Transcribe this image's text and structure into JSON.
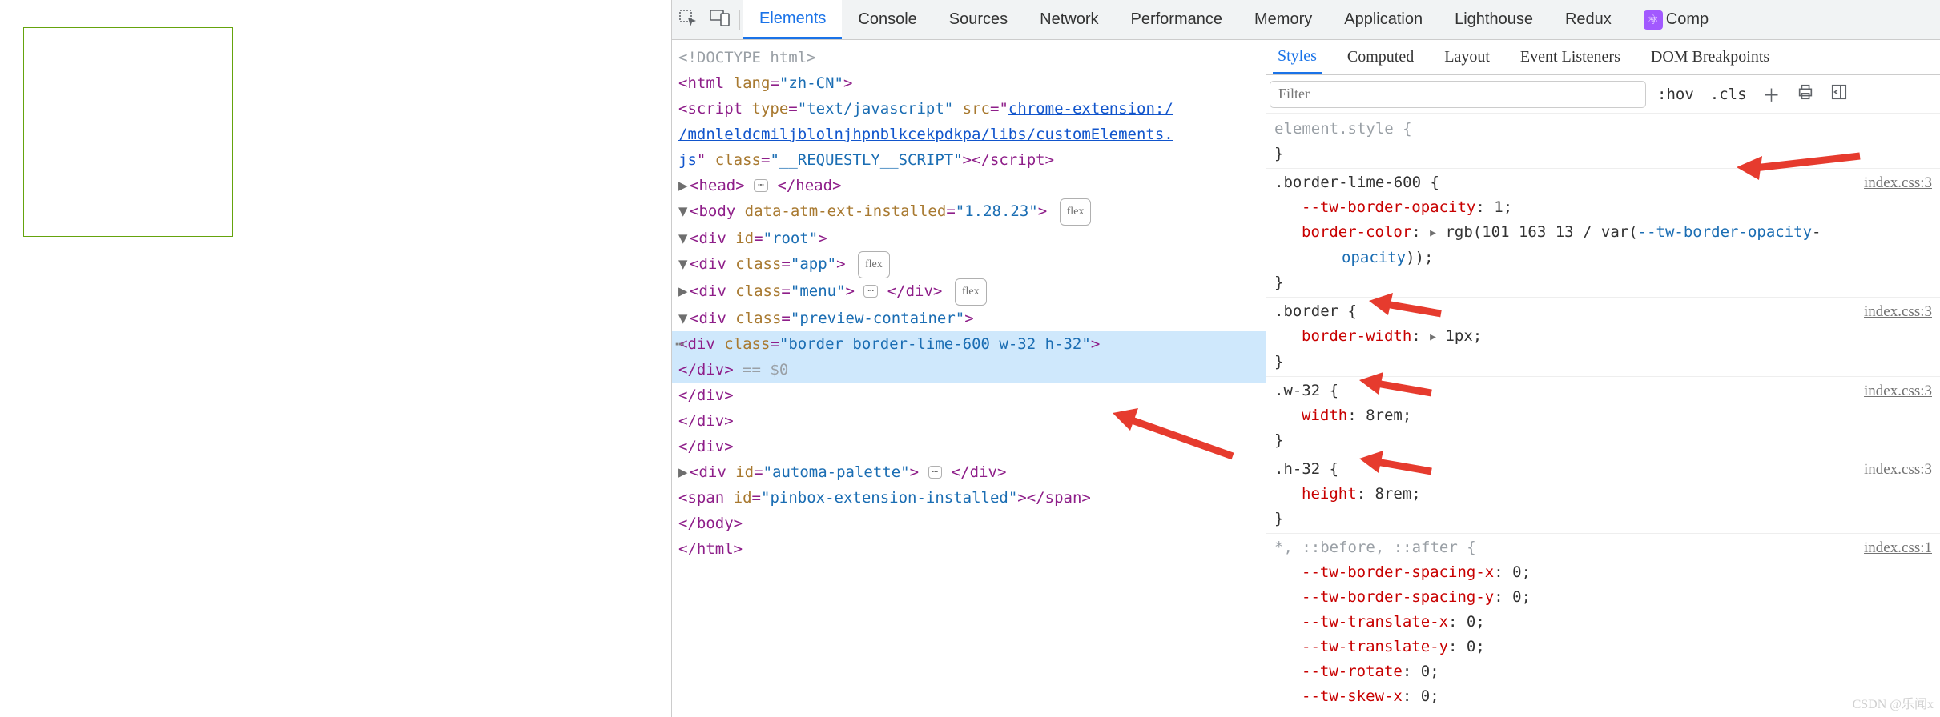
{
  "tabs": {
    "elements": "Elements",
    "console": "Console",
    "sources": "Sources",
    "network": "Network",
    "performance": "Performance",
    "memory": "Memory",
    "application": "Application",
    "lighthouse": "Lighthouse",
    "redux": "Redux",
    "comp": "Comp"
  },
  "subtabs": {
    "styles": "Styles",
    "computed": "Computed",
    "layout": "Layout",
    "listeners": "Event Listeners",
    "dom": "DOM Breakpoints"
  },
  "filter": {
    "placeholder": "Filter",
    "hov": ":hov",
    "cls": ".cls"
  },
  "dom": {
    "doctype": "<!DOCTYPE html>",
    "html_open": [
      "html",
      " lang",
      "=",
      "\"zh-CN\""
    ],
    "script_open": [
      "script",
      " type",
      "=",
      "\"text/javascript\"",
      " src",
      "="
    ],
    "script_src_line1": "chrome-extension:/",
    "script_src_line2": "/mdnleldcmiljblolnjhpnblkcekpdkpa/libs/customElements.",
    "script_src_line3": "js",
    "script_class_attr": " class",
    "script_class_val": "\"__REQUESTLY__SCRIPT\"",
    "head": "head",
    "body_open": [
      "body",
      " data-atm-ext-installed",
      "=",
      "\"1.28.23\""
    ],
    "body_badge": "flex",
    "root": [
      "div",
      " id",
      "=",
      "\"root\""
    ],
    "app": [
      "div",
      " class",
      "=",
      "\"app\""
    ],
    "app_badge": "flex",
    "menu": [
      "div",
      " class",
      "=",
      "\"menu\""
    ],
    "menu_badge": "flex",
    "preview": [
      "div",
      " class",
      "=",
      "\"preview-container\""
    ],
    "selected": [
      "div",
      " class",
      "=",
      "\"border border-lime-600 w-32 h-32\""
    ],
    "close_div": "div",
    "dollar": " == $0",
    "automa": [
      "div",
      " id",
      "=",
      "\"automa-palette\""
    ],
    "span": [
      "span",
      " id",
      "=",
      "\"pinbox-extension-installed\""
    ],
    "close_body": "body",
    "close_html": "html"
  },
  "styles": {
    "element_style": "element.style {",
    "brace_close": "}",
    "src": "index.css:3",
    "src_star": "index.css:1",
    "r1_sel": ".border-lime-600 {",
    "r1_p1": "--tw-border-opacity",
    "r1_v1": "1",
    "r1_p2": "border-color",
    "r1_v2_a": "rgb(101 163 13 / var(",
    "r1_v2_b": "--tw-border-opacity",
    "r1_v2_c": "))",
    "r2_sel": ".border {",
    "r2_p": "border-width",
    "r2_v": "1px",
    "r3_sel": ".w-32 {",
    "r3_p": "width",
    "r3_v": "8rem",
    "r4_sel": ".h-32 {",
    "r4_p": "height",
    "r4_v": "8rem",
    "r5_sel": "*, ::before, ::after {",
    "r5_p1": "--tw-border-spacing-x",
    "r5_v1": "0",
    "r5_p2": "--tw-border-spacing-y",
    "r5_v2": "0",
    "r5_p3": "--tw-translate-x",
    "r5_v3": "0",
    "r5_p4": "--tw-translate-y",
    "r5_v4": "0",
    "r5_p5": "--tw-rotate",
    "r5_v5": "0",
    "r5_p6": "--tw-skew-x",
    "r5_v6": "0"
  },
  "watermark": "CSDN @乐闻x"
}
